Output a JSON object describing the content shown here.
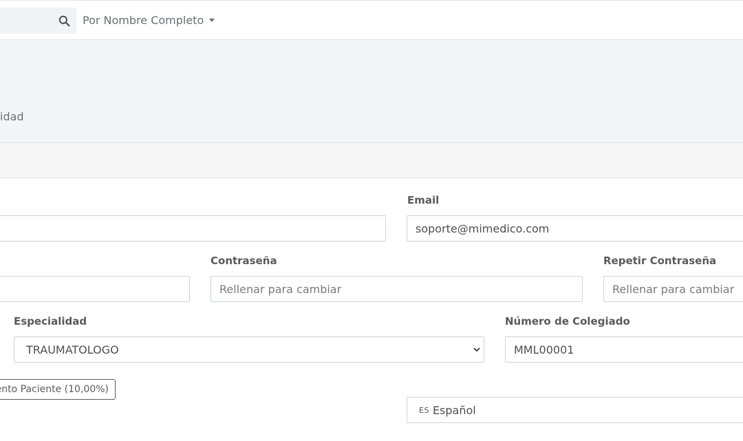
{
  "topbar": {
    "search_icon": "search-icon",
    "search_mode": "Por Nombre Completo"
  },
  "hero": {
    "text": "idad"
  },
  "form": {
    "email": {
      "label": "Email",
      "value": "soporte@mimedico.com"
    },
    "name": {
      "value": ""
    },
    "left_field": {
      "value": ""
    },
    "password": {
      "label": "Contraseña",
      "placeholder": "Rellenar para cambiar"
    },
    "repeat_password": {
      "label": "Repetir Contraseña",
      "placeholder": "Rellenar para cambiar"
    },
    "specialty": {
      "label": "Especialidad",
      "selected": "TRAUMATOLOGO"
    },
    "collegiate_number": {
      "label": "Número de Colegiado",
      "value": "MML00001"
    },
    "badge": "ento Paciente (10,00%)",
    "language": {
      "code": "ES",
      "label": "Español"
    }
  },
  "colors": {
    "hero_bg": "#f3f5f9",
    "border": "#cfd3d8",
    "label": "#5a5a5a"
  }
}
